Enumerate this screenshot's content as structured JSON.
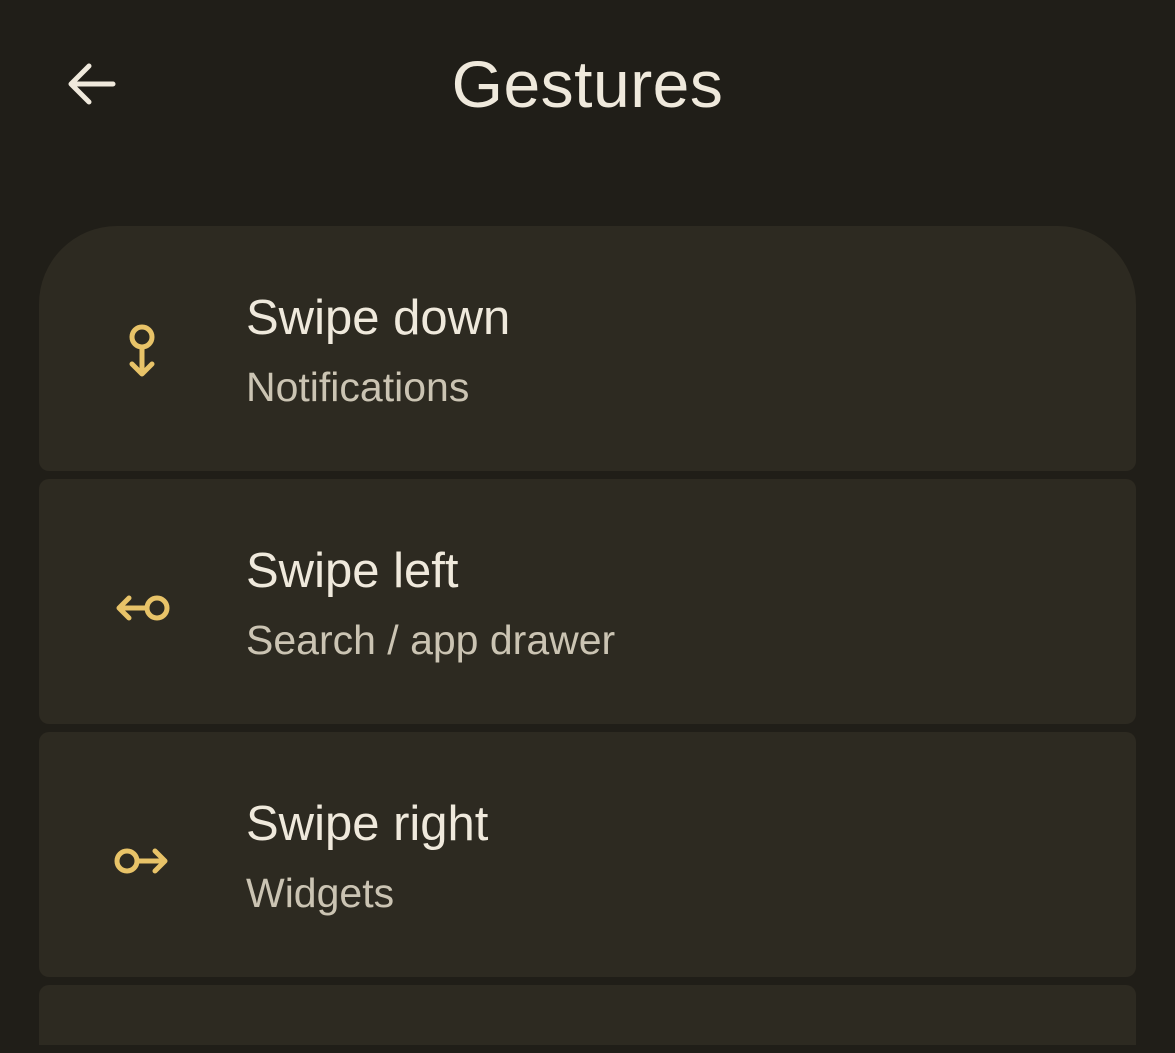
{
  "header": {
    "title": "Gestures",
    "back_icon": "arrow-back-icon"
  },
  "colors": {
    "background": "#201e18",
    "card": "#2d2a21",
    "accent": "#e8c368",
    "title_text": "#efe9dc",
    "subtitle_text": "#cbc4b3"
  },
  "gestures": [
    {
      "title": "Swipe down",
      "subtitle": "Notifications",
      "icon": "swipe-down-icon"
    },
    {
      "title": "Swipe left",
      "subtitle": "Search / app drawer",
      "icon": "swipe-left-icon"
    },
    {
      "title": "Swipe right",
      "subtitle": "Widgets",
      "icon": "swipe-right-icon"
    }
  ]
}
